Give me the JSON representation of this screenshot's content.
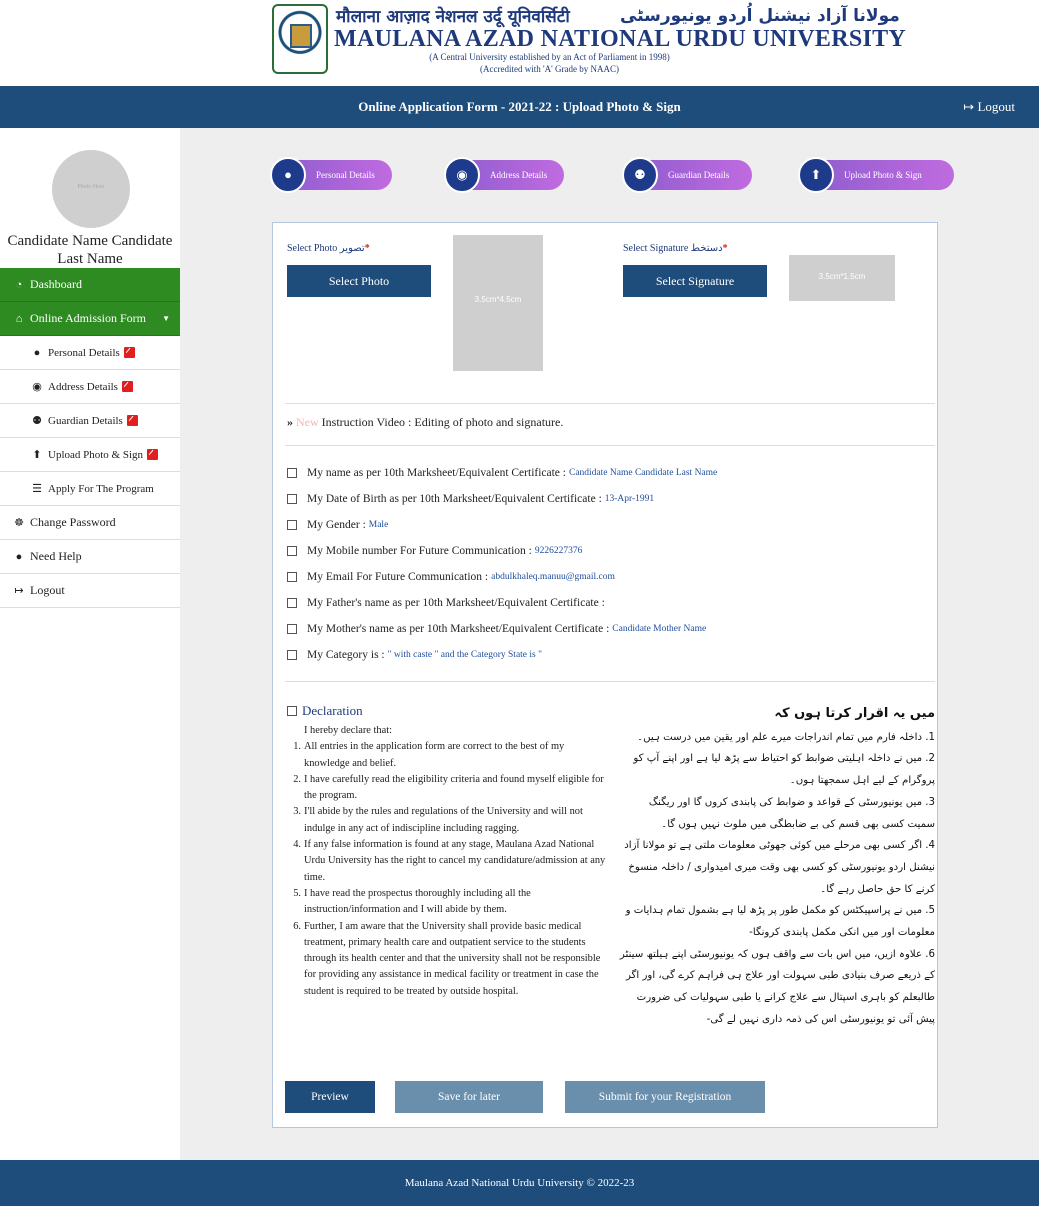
{
  "header": {
    "hindi_name": "मौलाना आज़ाद नेशनल उर्दू यूनिवर्सिटी",
    "urdu_name": "مولانا آزاد نیشنل اُردو یونیورسٹی",
    "english_name": "MAULANA AZAD NATIONAL URDU UNIVERSITY",
    "subtitle1": "(A Central University established by an Act of Parliament in 1998)",
    "subtitle2": "(Accredited with 'A' Grade by NAAC)"
  },
  "navbar": {
    "title": "Online Application Form - 2021-22 : Upload Photo & Sign",
    "logout": "Logout"
  },
  "sidebar": {
    "avatar_text": "Photo Here",
    "candidate_name": "Candidate Name Candidate Last Name",
    "items": [
      {
        "label": "Dashboard",
        "icon": "dashboard-icon"
      },
      {
        "label": "Online Admission Form",
        "icon": "home-icon"
      },
      {
        "label": "Personal Details",
        "icon": "user-icon"
      },
      {
        "label": "Address Details",
        "icon": "location-pin-icon"
      },
      {
        "label": "Guardian Details",
        "icon": "users-icon"
      },
      {
        "label": "Upload Photo & Sign",
        "icon": "upload-icon"
      },
      {
        "label": "Apply For The Program",
        "icon": "list-icon"
      },
      {
        "label": "Change Password",
        "icon": "key-icon"
      },
      {
        "label": "Need Help",
        "icon": "user-icon"
      },
      {
        "label": "Logout",
        "icon": "sign-out-icon"
      }
    ]
  },
  "steps": [
    {
      "label": "Personal Details",
      "icon": "user-icon"
    },
    {
      "label": "Address Details",
      "icon": "location-pin-icon"
    },
    {
      "label": "Guardian Details",
      "icon": "users-icon"
    },
    {
      "label": "Upload Photo & Sign",
      "icon": "upload-icon"
    }
  ],
  "upload": {
    "photo_label": "Select Photo",
    "photo_label_urdu": "تصویر",
    "photo_button": "Select Photo",
    "photo_size": "3.5cm*4.5cm",
    "sign_label": "Select Signature",
    "sign_label_urdu": "دستخط",
    "sign_button": "Select Signature",
    "sign_size": "3.5cm*1.5cm"
  },
  "instruction": {
    "new_tag": "New",
    "text": "Instruction Video : Editing of photo and signature."
  },
  "checks": [
    {
      "label": "My name as per 10th Marksheet/Equivalent Certificate :",
      "value": "Candidate Name Candidate Last Name"
    },
    {
      "label": "My Date of Birth as per 10th Marksheet/Equivalent Certificate :",
      "value": "13-Apr-1991"
    },
    {
      "label": "My Gender :",
      "value": "Male"
    },
    {
      "label": "My Mobile number For Future Communication :",
      "value": "9226227376"
    },
    {
      "label": "My Email For Future Communication :",
      "value": "abdulkhaleq.manuu@gmail.com"
    },
    {
      "label": "My Father's name as per 10th Marksheet/Equivalent Certificate :",
      "value": ""
    },
    {
      "label": "My Mother's name as per 10th Marksheet/Equivalent Certificate :",
      "value": "Candidate Mother Name"
    },
    {
      "label": "My Category is :",
      "value": "\" with caste \" and the Category State is \""
    }
  ],
  "declaration": {
    "title": "Declaration",
    "intro": "I hereby declare that:",
    "items": [
      "All entries in the application form are correct to the best of my knowledge and belief.",
      "I have carefully read the eligibility criteria and found myself eligible for the program.",
      "I'll abide by the rules and regulations of the University and will not indulge in any act of indiscipline including ragging.",
      "If any false information is found at any stage, Maulana Azad National Urdu University has the right to cancel my candidature/admission at any time.",
      "I have read the prospectus thoroughly including all the instruction/information and I will abide by them.",
      "Further, I am aware that the University shall provide basic medical treatment, primary health care and outpatient service to the students through its health center and that the university shall not be responsible for providing any assistance in medical facility or treatment in case the student is required to be treated by outside hospital."
    ],
    "urdu_heading": "میں یہ اقرار کرتا ہوں کہ",
    "urdu_items": [
      "1. داخلہ فارم میں تمام اندراجات میرے علم اور یقین میں درست ہیں۔",
      "2. میں نے داخلہ اہلیتی ضوابط کو احتیاط سے پڑھ لیا ہے اور اپنے آپ کو پروگرام کے لیے اہل سمجھتا ہوں۔",
      "3. میں یونیورسٹی کے قواعد و ضوابط کی پابندی کروں گا اور ریگنگ سمیت کسی بھی قسم کی بے ضابطگی میں ملوث نہیں ہوں گا۔",
      "4. اگر کسی بھی مرحلے میں کوئی جھوٹی معلومات ملتی ہے تو مولانا آزاد نیشنل اردو یونیورسٹی کو کسی بھی وقت میری امیدواری / داخلہ منسوخ کرنے کا حق حاصل رہے گا۔",
      "5. میں نے پراسپیکٹس کو مکمل طور پر پڑھ لیا ہے بشمول تمام ہدایات و معلومات اور میں انکی مکمل پابندی کرونگا-",
      "6. علاوہ ازیں، میں اس بات سے واقف ہوں کہ یونیورسٹی اپنے ہیلتھ سینٹر کے ذریعے صرف بنیادی طبی سہولت اور علاج ہی فراہم کرے گی، اور اگر طالبعلم کو باہری اسپتال سے علاج کرانے یا طبی سہولیات کی ضرورت پیش آئی تو یونیورسٹی اس کی ذمہ داری نہیں لے گی-"
    ]
  },
  "buttons": {
    "preview": "Preview",
    "save": "Save for later",
    "submit": "Submit for your Registration"
  },
  "footer": {
    "text": "Maulana Azad National Urdu University © 2022-23"
  },
  "colors": {
    "navy": "#1e4d7b",
    "green": "#2e8b22",
    "purple": "#a463d8",
    "grey_button": "#6a8fad",
    "red_badge": "#e02020"
  }
}
